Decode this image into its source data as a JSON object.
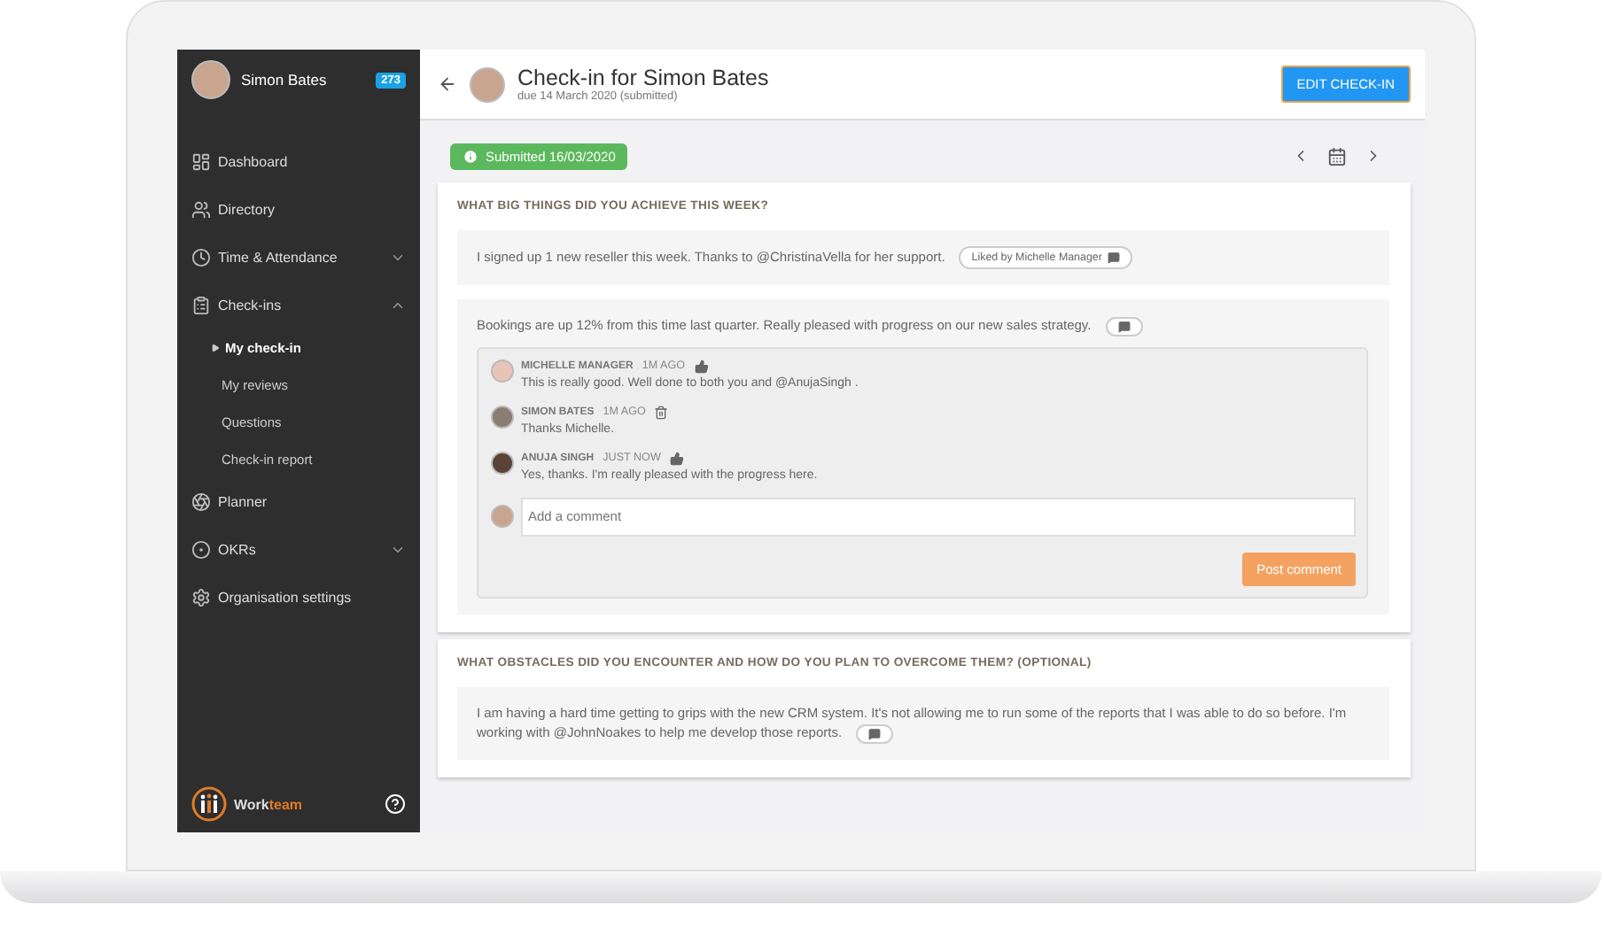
{
  "sidebar": {
    "user": {
      "name": "Simon Bates",
      "badge": "273"
    },
    "items": [
      {
        "label": "Dashboard"
      },
      {
        "label": "Directory"
      },
      {
        "label": "Time & Attendance",
        "expanded": false
      },
      {
        "label": "Check-ins",
        "expanded": true,
        "children": [
          {
            "label": "My check-in",
            "selected": true
          },
          {
            "label": "My reviews",
            "selected": false
          },
          {
            "label": "Questions",
            "selected": false
          },
          {
            "label": "Check-in report",
            "selected": false
          }
        ]
      },
      {
        "label": "Planner"
      },
      {
        "label": "OKRs",
        "expanded": false
      },
      {
        "label": "Organisation settings"
      }
    ],
    "logo": {
      "text": "Work",
      "accent": "team"
    }
  },
  "header": {
    "title": "Check-in for Simon Bates",
    "subtitle": "due 14 March 2020 (submitted)",
    "button": "EDIT CHECK-IN"
  },
  "status": "Submitted 16/03/2020",
  "questions": [
    {
      "title": "WHAT BIG THINGS DID YOU ACHIEVE THIS WEEK?",
      "answers": [
        {
          "text": "I signed up 1 new reseller this week. Thanks to @ChristinaVella for her support.",
          "reaction": "Liked by Michelle Manager"
        },
        {
          "text": "Bookings are up 12% from this time last quarter. Really pleased with progress on our new sales strategy.",
          "comments": [
            {
              "author": "MICHELLE MANAGER",
              "time": "1M AGO",
              "kind": "liked",
              "text": "This is really good. Well done to both you and @AnujaSingh ."
            },
            {
              "author": "SIMON BATES",
              "time": "1M AGO",
              "kind": "own",
              "text": "Thanks Michelle."
            },
            {
              "author": "ANUJA SINGH",
              "time": "JUST NOW",
              "kind": "liked",
              "text": "Yes, thanks. I'm really pleased with the progress here."
            }
          ],
          "comment_box": {
            "placeholder": "Add a comment",
            "button": "Post comment"
          }
        }
      ]
    },
    {
      "title": "WHAT OBSTACLES DID YOU ENCOUNTER AND HOW DO YOU PLAN TO OVERCOME THEM? (OPTIONAL)",
      "answers": [
        {
          "text": "I am having a hard time getting to grips with the new CRM system. It's not allowing me to run some of the reports that I was able to do so before. I'm working with @JohnNoakes to help me develop those reports."
        }
      ]
    }
  ]
}
